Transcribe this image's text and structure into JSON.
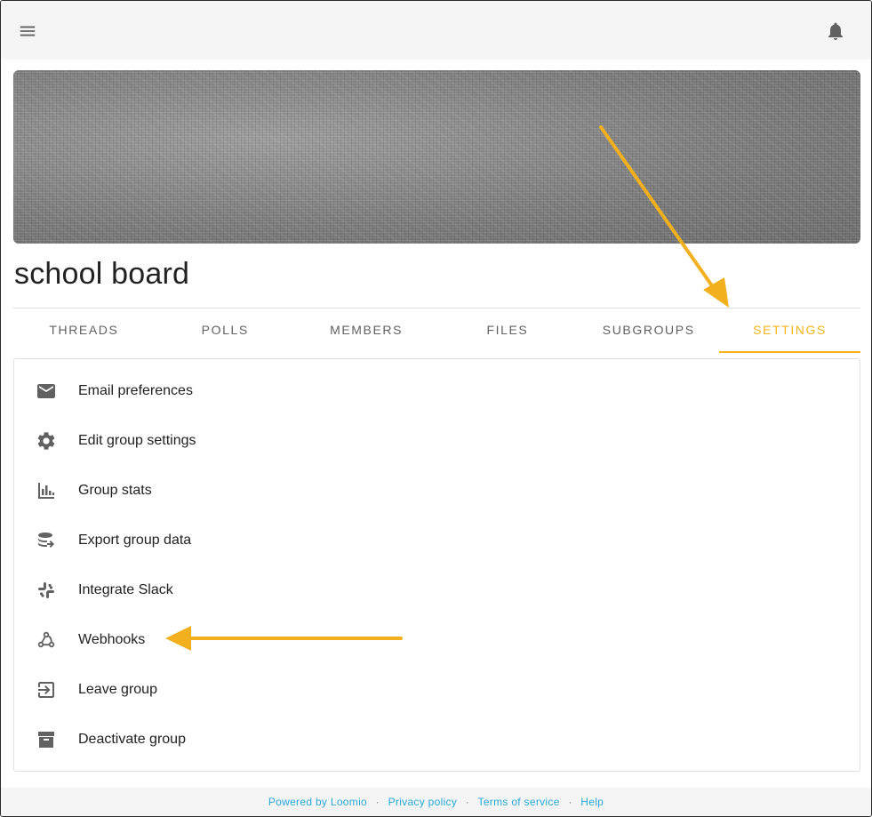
{
  "group": {
    "title": "school board"
  },
  "tabs": [
    {
      "label": "THREADS",
      "active": false
    },
    {
      "label": "POLLS",
      "active": false
    },
    {
      "label": "MEMBERS",
      "active": false
    },
    {
      "label": "FILES",
      "active": false
    },
    {
      "label": "SUBGROUPS",
      "active": false
    },
    {
      "label": "SETTINGS",
      "active": true
    }
  ],
  "settings_menu": [
    {
      "label": "Email preferences",
      "icon": "email-icon"
    },
    {
      "label": "Edit group settings",
      "icon": "gear-icon"
    },
    {
      "label": "Group stats",
      "icon": "bar-chart-icon"
    },
    {
      "label": "Export group data",
      "icon": "database-export-icon"
    },
    {
      "label": "Integrate Slack",
      "icon": "slack-icon"
    },
    {
      "label": "Webhooks",
      "icon": "webhook-icon"
    },
    {
      "label": "Leave group",
      "icon": "exit-icon"
    },
    {
      "label": "Deactivate group",
      "icon": "archive-icon"
    }
  ],
  "footer": {
    "powered_by": "Powered by Loomio",
    "privacy": "Privacy policy",
    "terms": "Terms of service",
    "help": "Help",
    "separator": "·"
  },
  "colors": {
    "accent": "#f4b41a",
    "annotation_arrow": "#f2b01e",
    "footer_link": "#29a8d6",
    "topbar_bg": "#f5f5f5",
    "icon": "#616161"
  }
}
